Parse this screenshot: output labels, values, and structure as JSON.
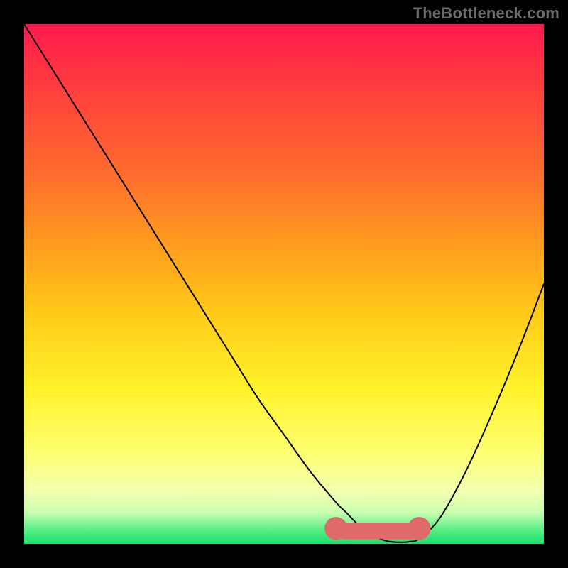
{
  "watermark": "TheBottleneck.com",
  "chart_data": {
    "type": "line",
    "title": "",
    "xlabel": "",
    "ylabel": "",
    "xlim": [
      0,
      100
    ],
    "ylim": [
      0,
      100
    ],
    "grid": false,
    "legend": false,
    "background_gradient": {
      "stops": [
        {
          "pct": 0,
          "color": "#ff1a4d"
        },
        {
          "pct": 12,
          "color": "#ff3d3d"
        },
        {
          "pct": 28,
          "color": "#ff6a2e"
        },
        {
          "pct": 42,
          "color": "#ff9a1f"
        },
        {
          "pct": 55,
          "color": "#ffc817"
        },
        {
          "pct": 70,
          "color": "#fff22a"
        },
        {
          "pct": 82,
          "color": "#feff6e"
        },
        {
          "pct": 90,
          "color": "#f3ffb0"
        },
        {
          "pct": 94,
          "color": "#c8ffb0"
        },
        {
          "pct": 97,
          "color": "#5ff08a"
        },
        {
          "pct": 100,
          "color": "#18e06a"
        }
      ]
    },
    "series": [
      {
        "name": "bottleneck-curve",
        "stroke": "#000000",
        "stroke_width": 2,
        "x": [
          0,
          5,
          10,
          15,
          20,
          25,
          30,
          35,
          40,
          45,
          50,
          55,
          60,
          62,
          65,
          68,
          70,
          72,
          74,
          76,
          80,
          85,
          90,
          95,
          100
        ],
        "y": [
          100,
          92,
          84,
          76,
          68,
          60,
          52,
          44,
          36,
          28,
          21,
          14,
          8,
          6,
          3,
          1.2,
          0.5,
          0.3,
          0.4,
          1.0,
          5,
          14,
          25,
          37,
          50
        ]
      }
    ],
    "highlight_band": {
      "name": "optimal-range",
      "color": "#e06a6a",
      "x_start": 60,
      "x_end": 76,
      "y": 2.5,
      "thickness": 3.2,
      "endcap_radius": 2.2
    }
  }
}
